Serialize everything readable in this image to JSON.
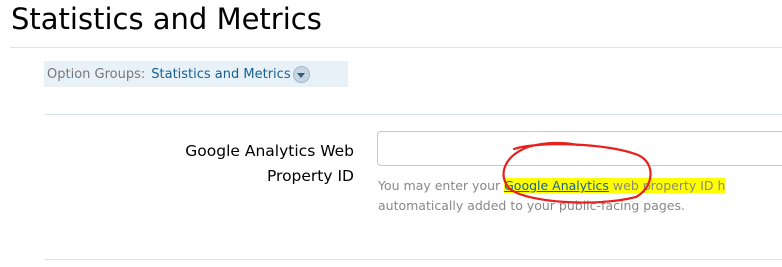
{
  "page": {
    "title": "Statistics and Metrics"
  },
  "option_groups": {
    "label": "Option Groups:",
    "current": "Statistics and Metrics",
    "toggle_icon": "chevron-down-circle-icon"
  },
  "field": {
    "label": "Google Analytics Web Property ID",
    "value": "",
    "explain_before": "You may enter your ",
    "explain_link": "Google Analytics",
    "explain_after": " web property ID h",
    "explain_line2": "automatically added to your public-facing pages."
  },
  "colors": {
    "link": "#176093",
    "highlight": "#ffff00",
    "annotation": "#e8201c",
    "rule": "#d7e5f2"
  }
}
